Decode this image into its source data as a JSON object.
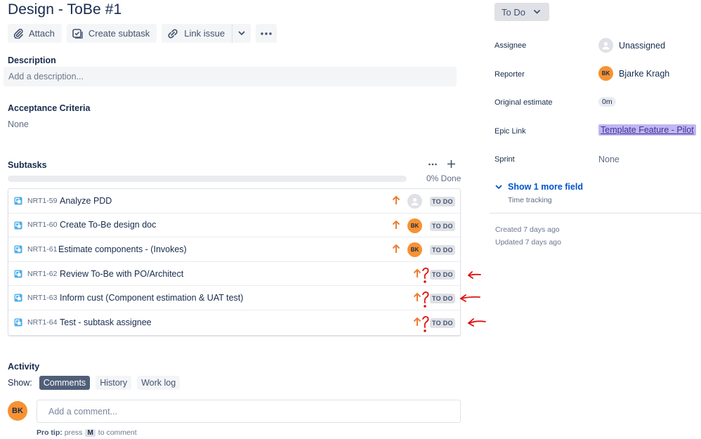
{
  "issue": {
    "title": "Design - ToBe #1"
  },
  "toolbar": {
    "attach": "Attach",
    "create_subtask": "Create subtask",
    "link_issue": "Link issue"
  },
  "description": {
    "label": "Description",
    "placeholder": "Add a description..."
  },
  "acceptance": {
    "label": "Acceptance Criteria",
    "value": "None"
  },
  "subtasks": {
    "label": "Subtasks",
    "progress_label": "0% Done",
    "progress_fraction": 0,
    "items": [
      {
        "key": "NRT1-59",
        "summary": "Analyze PDD",
        "status": "TO DO",
        "assignee": "unassigned"
      },
      {
        "key": "NRT1-60",
        "summary": "Create To-Be design doc",
        "status": "TO DO",
        "assignee": "BK"
      },
      {
        "key": "NRT1-61",
        "summary": "Estimate components - (Invokes)",
        "status": "TO DO",
        "assignee": "BK"
      },
      {
        "key": "NRT1-62",
        "summary": "Review To-Be with PO/Architect",
        "status": "TO DO",
        "assignee": ""
      },
      {
        "key": "NRT1-63",
        "summary": "Inform cust (Component estimation & UAT test)",
        "status": "TO DO",
        "assignee": ""
      },
      {
        "key": "NRT1-64",
        "summary": "Test - subtask assignee",
        "status": "TO DO",
        "assignee": ""
      }
    ]
  },
  "activity": {
    "label": "Activity",
    "show_label": "Show:",
    "tabs": [
      "Comments",
      "History",
      "Work log"
    ],
    "active_tab": "Comments",
    "avatar": "BK",
    "comment_placeholder": "Add a comment...",
    "protip_bold": "Pro tip:",
    "protip_press": "press",
    "protip_key": "M",
    "protip_rest": "to comment"
  },
  "sidebar": {
    "status": "To Do",
    "fields": {
      "assignee_label": "Assignee",
      "assignee_value": "Unassigned",
      "reporter_label": "Reporter",
      "reporter_value": "Bjarke Kragh",
      "reporter_initials": "BK",
      "estimate_label": "Original estimate",
      "estimate_value": "0m",
      "epic_label": "Epic Link",
      "epic_value": "Template Feature - Pilot",
      "sprint_label": "Sprint",
      "sprint_value": "None"
    },
    "show_more": "Show 1 more field",
    "time_tracking": "Time tracking",
    "created": "Created 7 days ago",
    "updated": "Updated 7 days ago"
  },
  "colors": {
    "priority": "#e97f33",
    "annotation": "#e01010",
    "avatar": "#f79232",
    "link": "#0052cc"
  }
}
